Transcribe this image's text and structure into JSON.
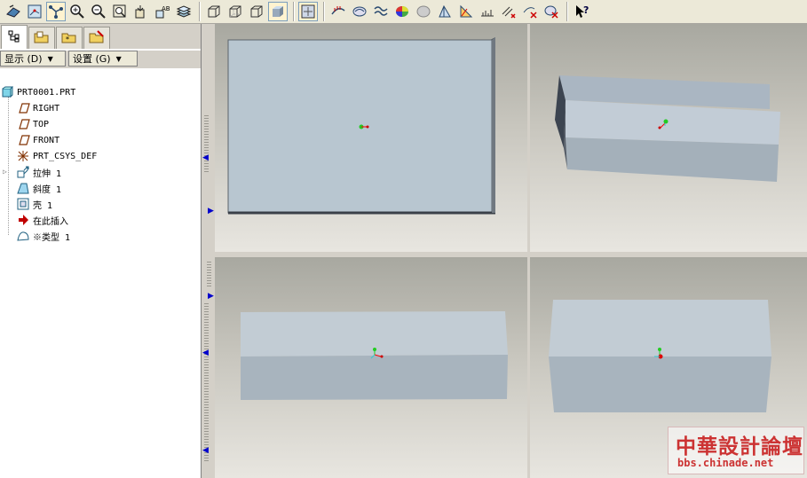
{
  "toolbar": {
    "icons": [
      "redraw-icon",
      "spin-center-icon",
      "orient-icon",
      "zoom-in-icon",
      "zoom-out-icon",
      "refit-icon",
      "view-manager-icon",
      "saved-views-icon",
      "layers-icon",
      "wireframe-icon",
      "hidden-line-icon",
      "no-hidden-icon",
      "shading-icon",
      "datum-display-icon",
      "curvature-icon",
      "section-icon",
      "reflection-icon",
      "draft-icon",
      "shaded-curvature-icon",
      "dihedral-icon",
      "deviation-icon",
      "graph-icon",
      "offset-icon",
      "delete-analysis-icon",
      "delete-all-icon",
      "whats-this-icon"
    ]
  },
  "panel": {
    "menu_show": "显示 (D)",
    "menu_settings": "设置 (G)"
  },
  "tree": {
    "items": [
      {
        "label": "PRT0001.PRT",
        "icon": "part-icon"
      },
      {
        "label": "RIGHT",
        "icon": "datum-plane-icon"
      },
      {
        "label": "TOP",
        "icon": "datum-plane-icon"
      },
      {
        "label": "FRONT",
        "icon": "datum-plane-icon"
      },
      {
        "label": "PRT_CSYS_DEF",
        "icon": "csys-icon"
      },
      {
        "label": "拉伸 1",
        "icon": "extrude-icon"
      },
      {
        "label": "斜度 1",
        "icon": "draft-feature-icon"
      },
      {
        "label": "壳 1",
        "icon": "shell-icon"
      },
      {
        "label": "在此插入",
        "icon": "insert-here-icon"
      },
      {
        "label": "※类型 1",
        "icon": "style-feature-icon"
      }
    ]
  },
  "colors": {
    "accent": "#7b9ebd",
    "face_light": "#c2ccd4",
    "face_dark": "#a4b0ba"
  },
  "watermark": {
    "title": "中華設計論壇",
    "url": "bbs.chinade.net"
  }
}
